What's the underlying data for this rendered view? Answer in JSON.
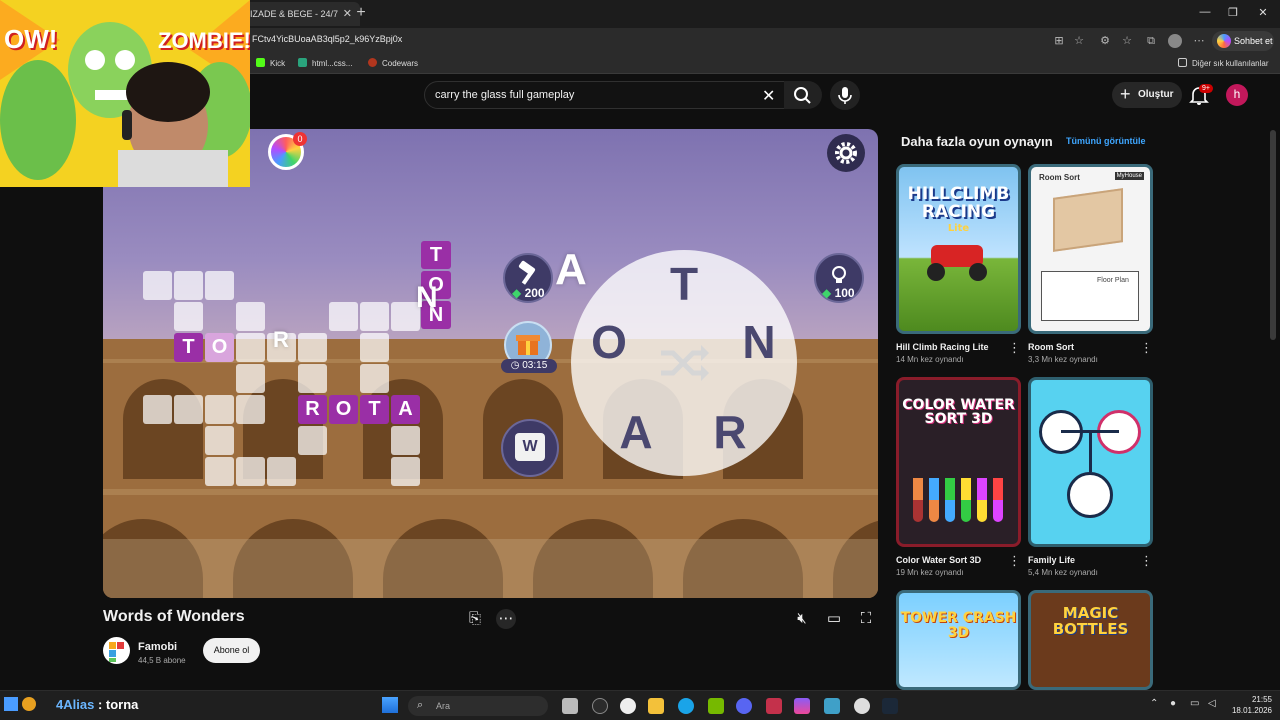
{
  "browser": {
    "tab_title": "IZADE & BEGE - 24/7",
    "url": "FCtv4YicBUoaAB3ql5p2_k96YzBpj0x",
    "chat_button": "Sohbet et",
    "bookmarks": [
      "Kick",
      "html...css...",
      "Codewars"
    ],
    "other_bookmarks": "Diğer sık kullanılanlar"
  },
  "youtube": {
    "search_query": "carry the glass full gameplay",
    "create_label": "Oluştur",
    "notification_count": "9+",
    "avatar_letter": "h"
  },
  "game": {
    "hammer_cost": "200",
    "hint_cost": "100",
    "timer": "03:15",
    "wheel_letters": [
      "T",
      "O",
      "N",
      "A",
      "R"
    ],
    "drag_letter": "A",
    "placed_word": [
      "R",
      "O",
      "T",
      "A"
    ],
    "partial_word": [
      "T",
      "O"
    ],
    "vertical_word": [
      "T",
      "O",
      "N"
    ],
    "partial_letter_r": "R",
    "wheel_badge": "0",
    "ad_icon_letter": "W"
  },
  "video": {
    "title": "Words of Wonders",
    "channel": "Famobi",
    "subscribers": "44,5 B abone",
    "subscribe_label": "Abone ol"
  },
  "sidebar": {
    "heading": "Daha fazla oyun oynayın",
    "see_all": "Tümünü görüntüle",
    "games": [
      {
        "title": "Hill Climb Racing Lite",
        "plays": "14 Mn kez oynandı"
      },
      {
        "title": "Room Sort",
        "plays": "3,3 Mn kez oynandı"
      },
      {
        "title": "Color Water Sort 3D",
        "plays": "19 Mn kez oynandı"
      },
      {
        "title": "Family Life",
        "plays": "5,4 Mn kez oynandı"
      },
      {
        "title": "TOWER CRASH 3D",
        "plays": ""
      },
      {
        "title": "MAGIC BOTTLES",
        "plays": ""
      }
    ],
    "thumb_text": {
      "hill_climb": "HILLCLIMB RACING",
      "hill_climb_sub": "Lite",
      "room_sort": "Room Sort",
      "room_sort_badge": "MyHouse",
      "room_sort_sub": "Floor Plan",
      "color_water": "COLOR WATER SORT 3D",
      "tower": "TOWER CRASH 3D",
      "magic": "MAGIC BOTTLES"
    }
  },
  "webcam": {
    "comic_left": "OW!",
    "comic_right": "ZOMBIE!"
  },
  "taskbar": {
    "search_placeholder": "Ara",
    "time": "21:55",
    "date": "18.01.2026"
  },
  "stream_overlay": {
    "name": "4Alias",
    "text": ": torna"
  },
  "colors": {
    "accent_blue": "#3ea6ff",
    "tile_purple": "#9a2fa6",
    "bell_badge": "#cc0000"
  }
}
